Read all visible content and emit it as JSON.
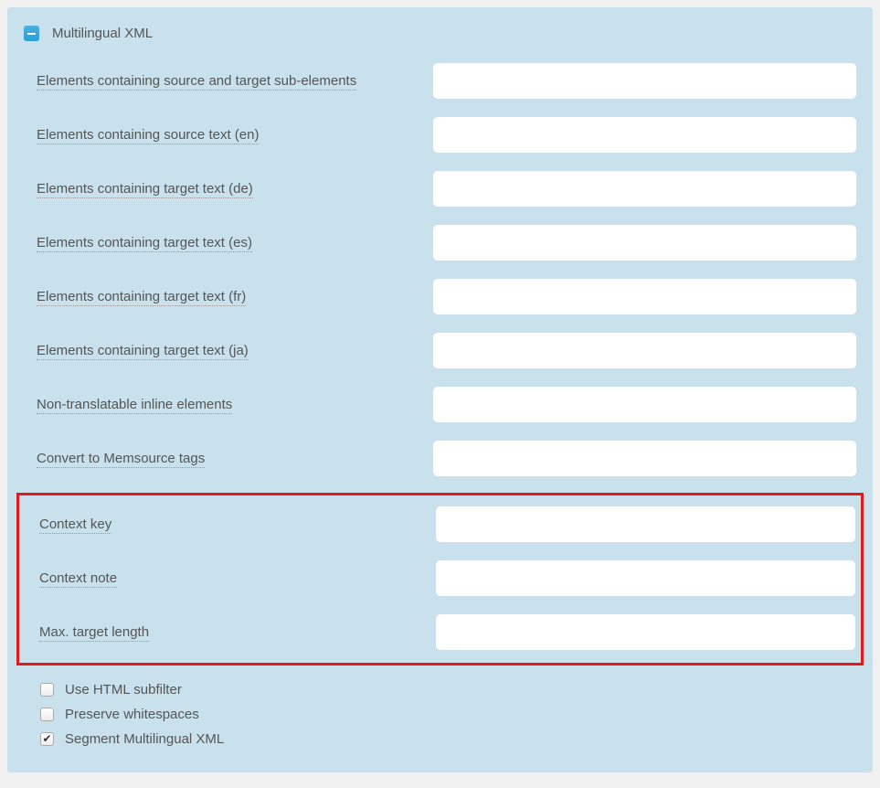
{
  "panel": {
    "title": "Multilingual XML",
    "fields": [
      {
        "label": "Elements containing source and target sub-elements",
        "value": ""
      },
      {
        "label": "Elements containing source text (en)",
        "value": ""
      },
      {
        "label": "Elements containing target text (de)",
        "value": ""
      },
      {
        "label": "Elements containing target text (es)",
        "value": ""
      },
      {
        "label": "Elements containing target text (fr)",
        "value": ""
      },
      {
        "label": "Elements containing target text (ja)",
        "value": ""
      },
      {
        "label": "Non-translatable inline elements",
        "value": ""
      },
      {
        "label": "Convert to Memsource tags",
        "value": ""
      }
    ],
    "highlighted_fields": [
      {
        "label": "Context key",
        "value": ""
      },
      {
        "label": "Context note",
        "value": ""
      },
      {
        "label": "Max. target length",
        "value": ""
      }
    ],
    "checkboxes": [
      {
        "label": "Use HTML subfilter",
        "checked": false
      },
      {
        "label": "Preserve whitespaces",
        "checked": false
      },
      {
        "label": "Segment Multilingual XML",
        "checked": true
      }
    ]
  }
}
